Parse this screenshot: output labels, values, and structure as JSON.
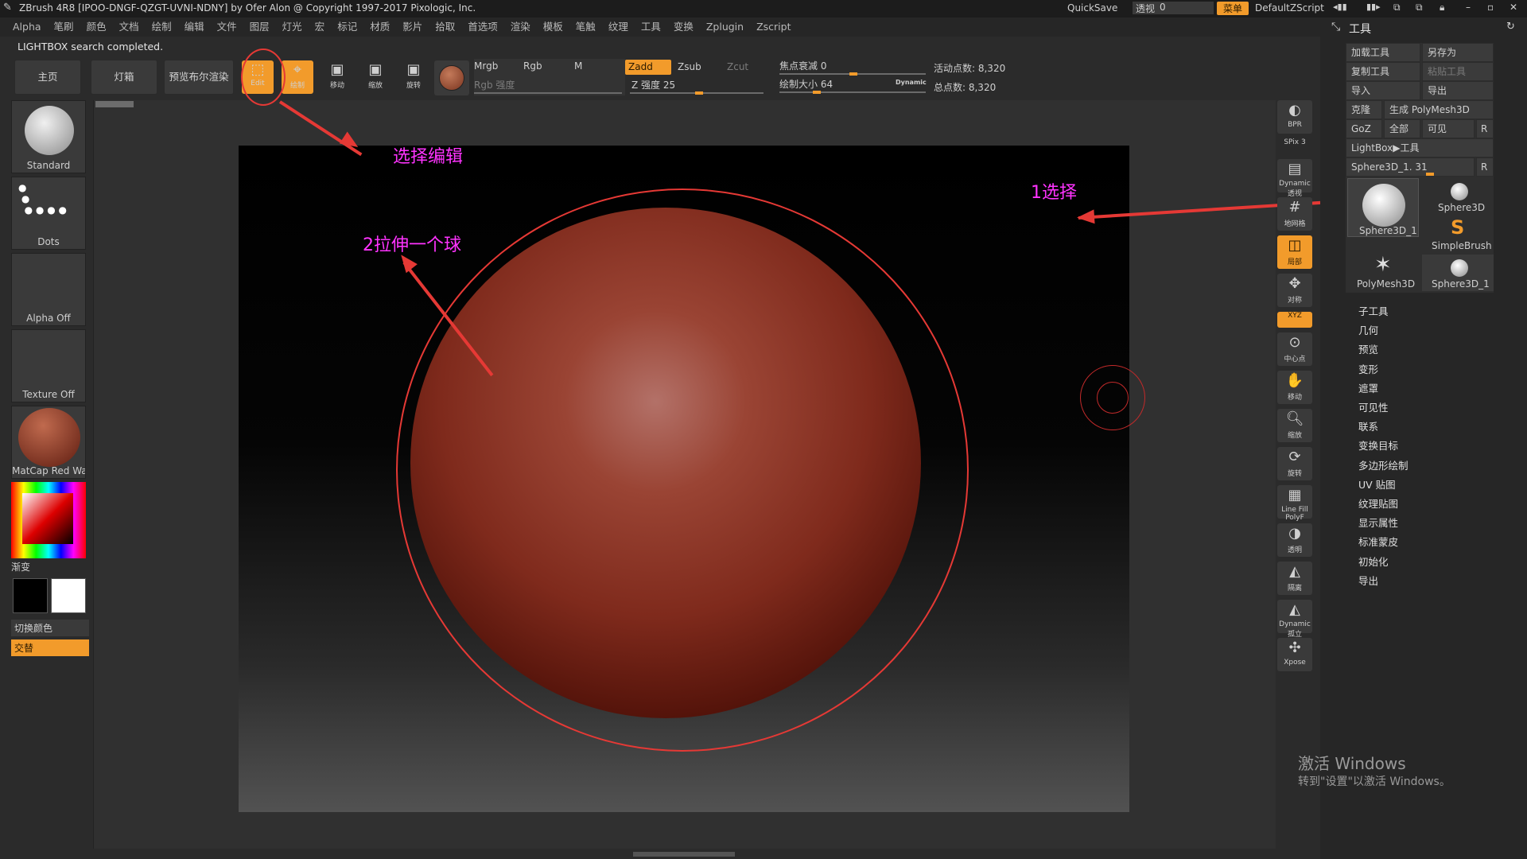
{
  "titlebar": {
    "title": "ZBrush 4R8 [IPOO-DNGF-QZGT-UVNI-NDNY] by Ofer Alon @ Copyright 1997-2017 Pixologic, Inc.",
    "quicksave": "QuickSave",
    "transparency_label": "透视",
    "transparency_value": "0",
    "menu_button": "菜单",
    "script": "DefaultZScript"
  },
  "menubar": [
    "Alpha",
    "笔刷",
    "颜色",
    "文档",
    "绘制",
    "编辑",
    "文件",
    "图层",
    "灯光",
    "宏",
    "标记",
    "材质",
    "影片",
    "拾取",
    "首选项",
    "渲染",
    "模板",
    "笔触",
    "纹理",
    "工具",
    "变换",
    "Zplugin",
    "Zscript"
  ],
  "status": "LIGHTBOX search completed.",
  "toolbar": {
    "home": "主页",
    "lightbox": "灯箱",
    "preview": "预览布尔渲染",
    "edit": "Edit",
    "draw": "绘制",
    "move": "移动",
    "scale": "缩放",
    "rotate": "旋转",
    "mrgb": "Mrgb",
    "rgb": "Rgb",
    "m": "M",
    "rgb_intensity": "Rgb 强度",
    "zadd": "Zadd",
    "zsub": "Zsub",
    "zcut": "Zcut",
    "z_intensity": "Z 强度 25",
    "focal_shift": "焦点衰减 0",
    "draw_size": "绘制大小 64",
    "dynamic": "Dynamic",
    "active_points": "活动点数: 8,320",
    "total_points": "总点数: 8,320"
  },
  "left": {
    "brush": "Standard",
    "stroke": "Dots",
    "alpha": "Alpha Off",
    "texture": "Texture Off",
    "material": "MatCap Red Wax",
    "gradient": "渐变",
    "switch_color": "切换颜色",
    "alternate": "交替"
  },
  "annotations": {
    "select_edit": "选择编辑",
    "step1": "1选择",
    "step2": "2拉伸一个球"
  },
  "right_shelf": [
    "BPR",
    "SPix 3",
    "Dynamic 透视",
    "地网格",
    "局部",
    "对称",
    "XYZ",
    "中心点",
    "移动",
    "缩放",
    "旋转",
    "Line Fill PolyF",
    "透明",
    "隔离",
    "Dynamic 孤立",
    "Xpose"
  ],
  "tool_panel": {
    "title": "工具",
    "load": "加载工具",
    "save_as": "另存为",
    "copy": "复制工具",
    "paste": "粘贴工具",
    "import": "导入",
    "export": "导出",
    "clone": "克隆",
    "make_polymesh": "生成 PolyMesh3D",
    "goz": "GoZ",
    "all": "全部",
    "visible": "可见",
    "r": "R",
    "lightbox_tools": "LightBox▶工具",
    "current_tool": "Sphere3D_1. 31",
    "thumbs": [
      "Sphere3D_1",
      "Sphere3D",
      "SimpleBrush",
      "PolyMesh3D",
      "Sphere3D_1"
    ],
    "subpalettes": [
      "子工具",
      "几何",
      "预览",
      "变形",
      "遮罩",
      "可见性",
      "联系",
      "变换目标",
      "多边形绘制",
      "UV 贴图",
      "纹理贴图",
      "显示属性",
      "标准蒙皮",
      "初始化",
      "导出"
    ]
  },
  "watermark": {
    "line1": "激活 Windows",
    "line2": "转到\"设置\"以激活 Windows。"
  }
}
